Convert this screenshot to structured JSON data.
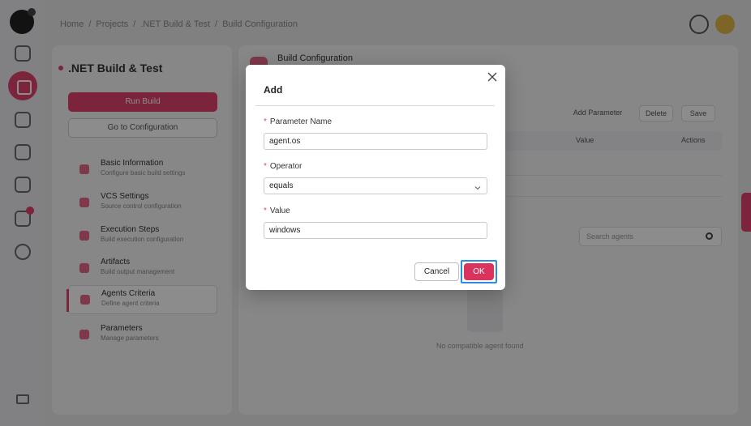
{
  "background": {
    "breadcrumb": [
      "Home",
      "/",
      "Projects",
      "/",
      ".NET Build & Test",
      "/",
      "Build Configuration"
    ],
    "project_title": ".NET Build & Test",
    "run_button": "Run Build",
    "config_button": "Go to Configuration",
    "nav_items": [
      {
        "title": "Basic Information",
        "subtitle": "Configure basic build settings"
      },
      {
        "title": "VCS Settings",
        "subtitle": "Source control configuration"
      },
      {
        "title": "Execution Steps",
        "subtitle": "Build execution configuration"
      },
      {
        "title": "Artifacts",
        "subtitle": "Build output management"
      },
      {
        "title": "Agents Criteria",
        "subtitle": "Define agent criteria"
      },
      {
        "title": "Parameters",
        "subtitle": "Manage parameters"
      }
    ],
    "content_title": "Build Configuration",
    "toolbar": {
      "add": "Add Parameter",
      "delete": "Delete",
      "save": "Save"
    },
    "table_headers": {
      "value": "Value",
      "actions": "Actions"
    },
    "search_placeholder": "Search agents",
    "empty_text": "No compatible agent found"
  },
  "modal": {
    "title": "Add",
    "fields": {
      "parameter_name": {
        "label": "Parameter Name",
        "value": "agent.os",
        "required": "*"
      },
      "operator": {
        "label": "Operator",
        "value": "equals",
        "required": "*"
      },
      "value": {
        "label": "Value",
        "value": "windows",
        "required": "*"
      }
    },
    "cancel_label": "Cancel",
    "ok_label": "OK"
  },
  "colors": {
    "accent": "#d9335e",
    "focus_outline": "#2b8be6"
  }
}
